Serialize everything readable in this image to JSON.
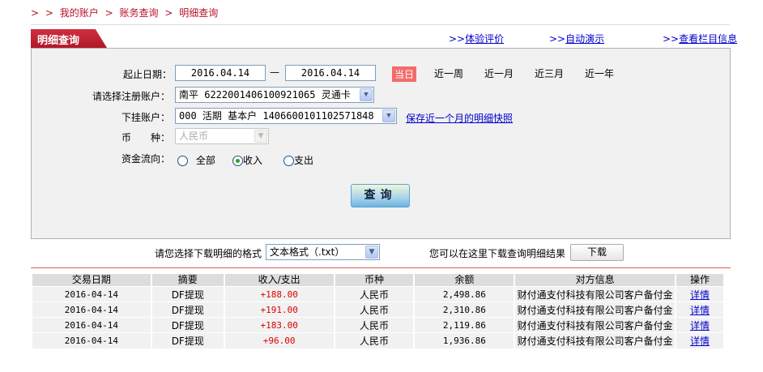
{
  "breadcrumb": {
    "prefix": ">",
    "items": [
      "我的账户",
      "账务查询",
      "明细查询"
    ]
  },
  "tab": {
    "title": "明细查询"
  },
  "top_links": [
    {
      "prefix": ">>",
      "label": "体验评价"
    },
    {
      "prefix": ">>",
      "label": "自动演示"
    },
    {
      "prefix": ">>",
      "label": "查看栏目信息"
    }
  ],
  "form": {
    "date_label": "起止日期：",
    "start_date": "2016.04.14",
    "date_sep": "—",
    "end_date": "2016.04.14",
    "quick_ranges": [
      "当日",
      "近一周",
      "近一月",
      "近三月",
      "近一年"
    ],
    "quick_selected": "当日",
    "account_label": "请选择注册账户：",
    "account_value": "南平  6222001406100921065  灵通卡",
    "sub_account_label": "下挂账户：",
    "sub_account_value": "000  活期  基本户  1406600101102571848",
    "snapshot_link": "保存近一个月的明细快照",
    "currency_label": "币　　种：",
    "currency_value": "人民币",
    "flow_label": "资金流向：",
    "flow_options": [
      "全部",
      "收入",
      "支出"
    ],
    "flow_selected": "收入",
    "query_button": "查询"
  },
  "download": {
    "format_label": "请您选择下载明细的格式",
    "format_value": "文本格式（.txt）",
    "hint": "您可以在这里下载查询明细结果",
    "button": "下载"
  },
  "table": {
    "headers": [
      "交易日期",
      "摘要",
      "收入/支出",
      "币种",
      "余额",
      "对方信息",
      "操作"
    ],
    "rows": [
      [
        "2016-04-14",
        "DF提现",
        "+188.00",
        "人民币",
        "2,498.86",
        "财付通支付科技有限公司客户备付金",
        "详情"
      ],
      [
        "2016-04-14",
        "DF提现",
        "+191.00",
        "人民币",
        "2,310.86",
        "财付通支付科技有限公司客户备付金",
        "详情"
      ],
      [
        "2016-04-14",
        "DF提现",
        "+183.00",
        "人民币",
        "2,119.86",
        "财付通支付科技有限公司客户备付金",
        "详情"
      ],
      [
        "2016-04-14",
        "DF提现",
        "+96.00",
        "人民币",
        "1,936.86",
        "财付通支付科技有限公司客户备付金",
        "详情"
      ]
    ]
  },
  "colors": {
    "brand_red": "#b8102a",
    "today_bg": "#f46b6b",
    "amount": "#e00000",
    "link": "#0000cc"
  }
}
